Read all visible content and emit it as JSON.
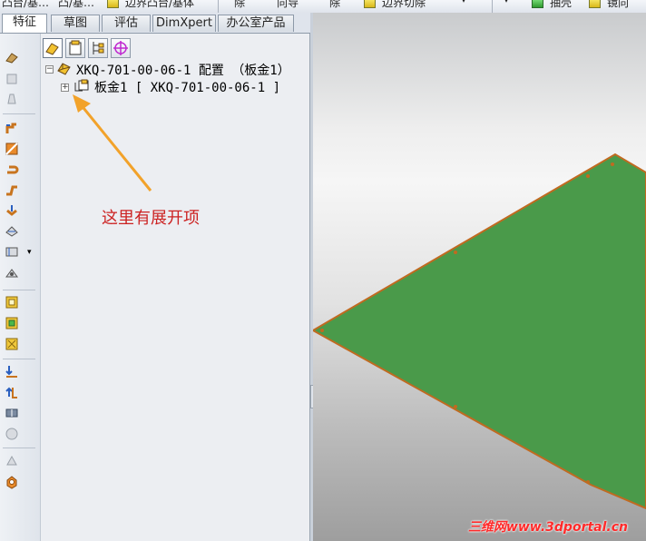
{
  "toolbar": {
    "items": [
      "凸台/基…",
      "凸/基…",
      "边界凸台/基体",
      "除",
      "向导",
      "除",
      "边界切除",
      "抽壳",
      "镜向"
    ]
  },
  "tabs": [
    {
      "label": "特征",
      "active": true
    },
    {
      "label": "草图",
      "active": false
    },
    {
      "label": "评估",
      "active": false
    },
    {
      "label": "DimXpert",
      "active": false
    },
    {
      "label": "办公室产品",
      "active": false
    }
  ],
  "tree": {
    "root_label": "XKQ-701-00-06-1 配置 （板金1）",
    "child_label": "板金1 [ XKQ-701-00-06-1 ]",
    "root_expander": "−",
    "child_expander": "+"
  },
  "annotation": "这里有展开项",
  "watermark": "三维网www.3dportal.cn",
  "colors": {
    "sheet_fill": "#4a9a4a",
    "sheet_edge": "#c06a20",
    "annotation_text": "#cc2222",
    "arrow": "#f2a22a",
    "watermark": "#ff2a2a"
  }
}
